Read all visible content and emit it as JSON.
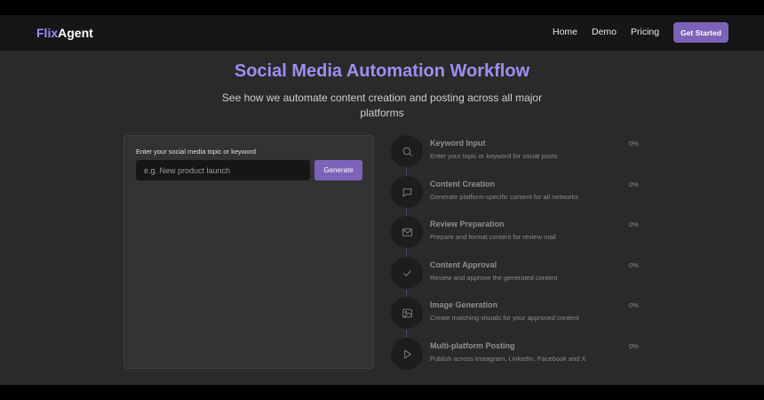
{
  "nav": {
    "logo_part1": "Flix",
    "logo_part2": "Agent",
    "links": [
      "Home",
      "Demo",
      "Pricing"
    ],
    "cta_label": "Get Started"
  },
  "hero": {
    "title": "Social Media Automation Workflow",
    "subtitle": "See how we automate content creation and posting across all major platforms"
  },
  "input_panel": {
    "label": "Enter your social media topic or keyword",
    "input_value": "",
    "input_placeholder": "e.g. New product launch",
    "button_label": "Generate"
  },
  "steps": [
    {
      "title": "Keyword Input",
      "desc": "Enter your topic or keyword for social posts",
      "progress": "0%",
      "icon": "search-icon"
    },
    {
      "title": "Content Creation",
      "desc": "Generate platform-specific content for all networks",
      "progress": "0%",
      "icon": "message-icon"
    },
    {
      "title": "Review Preparation",
      "desc": "Prepare and format content for review mail",
      "progress": "0%",
      "icon": "mail-icon"
    },
    {
      "title": "Content Approval",
      "desc": "Review and approve the generated content",
      "progress": "0%",
      "icon": "check-icon"
    },
    {
      "title": "Image Generation",
      "desc": "Create matching visuals for your approved content",
      "progress": "0%",
      "icon": "image-icon"
    },
    {
      "title": "Multi-platform Posting",
      "desc": "Publish across Instagram, LinkedIn, Facebook and X",
      "progress": "0%",
      "icon": "play-icon"
    }
  ],
  "colors": {
    "accent": "#7c62b8",
    "title": "#a08cf2",
    "background": "#2a2a2a",
    "nav_background": "#161616"
  }
}
